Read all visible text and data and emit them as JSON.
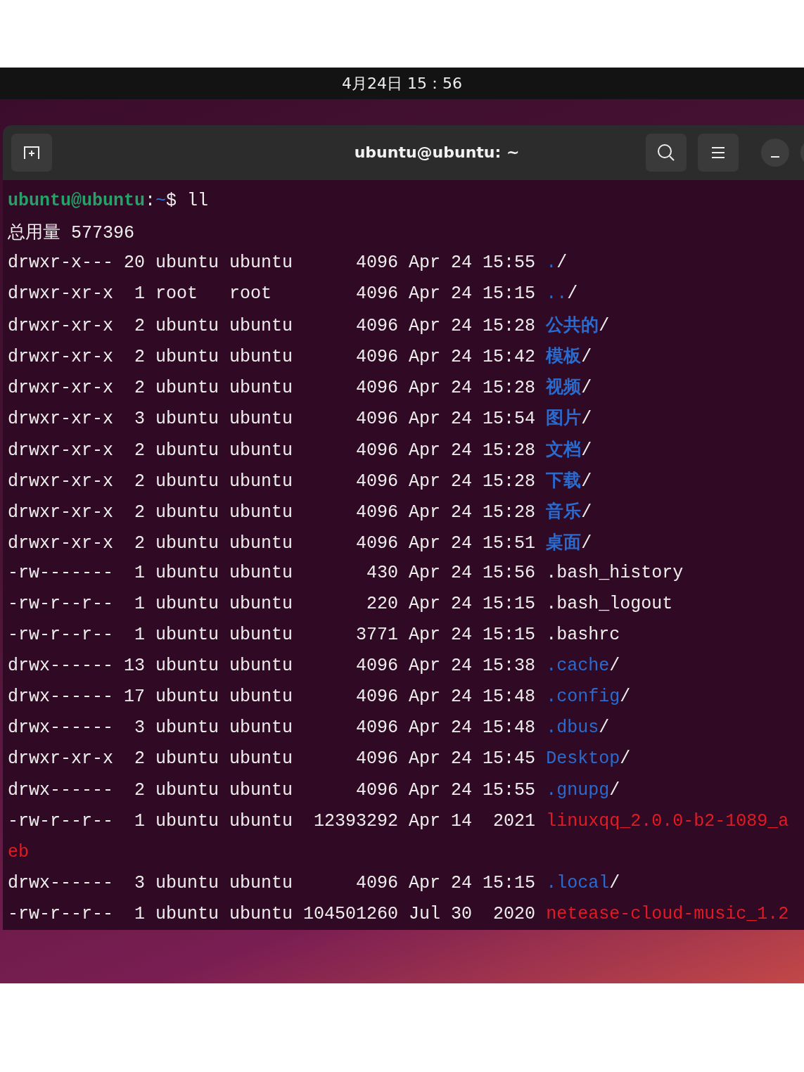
{
  "top_bar": {
    "clock": "4月24日 15：56"
  },
  "window": {
    "title": "ubuntu@ubuntu: ~"
  },
  "terminal": {
    "lines": [
      {
        "kind": "prompt_line",
        "user": "ubuntu@ubuntu",
        "separator": ":",
        "path": "~",
        "symbol": "$",
        "command": "ll"
      },
      {
        "kind": "text_line",
        "text": "总用量 577396"
      },
      {
        "kind": "dir_entry",
        "listing": "drwxr-x--- 20 ubuntu ubuntu      4096 Apr 24 15:55",
        "name": ".",
        "suffix": "/"
      },
      {
        "kind": "dir_entry",
        "listing": "drwxr-xr-x  1 root   root        4096 Apr 24 15:15",
        "name": "..",
        "suffix": "/"
      },
      {
        "kind": "dir_entry",
        "listing": "drwxr-xr-x  2 ubuntu ubuntu      4096 Apr 24 15:28",
        "name": "公共的",
        "suffix": "/"
      },
      {
        "kind": "dir_entry",
        "listing": "drwxr-xr-x  2 ubuntu ubuntu      4096 Apr 24 15:42",
        "name": "模板",
        "suffix": "/"
      },
      {
        "kind": "dir_entry",
        "listing": "drwxr-xr-x  2 ubuntu ubuntu      4096 Apr 24 15:28",
        "name": "视频",
        "suffix": "/"
      },
      {
        "kind": "dir_entry",
        "listing": "drwxr-xr-x  3 ubuntu ubuntu      4096 Apr 24 15:54",
        "name": "图片",
        "suffix": "/"
      },
      {
        "kind": "dir_entry",
        "listing": "drwxr-xr-x  2 ubuntu ubuntu      4096 Apr 24 15:28",
        "name": "文档",
        "suffix": "/"
      },
      {
        "kind": "dir_entry",
        "listing": "drwxr-xr-x  2 ubuntu ubuntu      4096 Apr 24 15:28",
        "name": "下载",
        "suffix": "/"
      },
      {
        "kind": "dir_entry",
        "listing": "drwxr-xr-x  2 ubuntu ubuntu      4096 Apr 24 15:28",
        "name": "音乐",
        "suffix": "/"
      },
      {
        "kind": "dir_entry",
        "listing": "drwxr-xr-x  2 ubuntu ubuntu      4096 Apr 24 15:51",
        "name": "桌面",
        "suffix": "/"
      },
      {
        "kind": "file_entry",
        "listing": "-rw-------  1 ubuntu ubuntu       430 Apr 24 15:56",
        "name": ".bash_history"
      },
      {
        "kind": "file_entry",
        "listing": "-rw-r--r--  1 ubuntu ubuntu       220 Apr 24 15:15",
        "name": ".bash_logout"
      },
      {
        "kind": "file_entry",
        "listing": "-rw-r--r--  1 ubuntu ubuntu      3771 Apr 24 15:15",
        "name": ".bashrc"
      },
      {
        "kind": "dir_entry",
        "listing": "drwx------ 13 ubuntu ubuntu      4096 Apr 24 15:38",
        "name": ".cache",
        "suffix": "/"
      },
      {
        "kind": "dir_entry",
        "listing": "drwx------ 17 ubuntu ubuntu      4096 Apr 24 15:48",
        "name": ".config",
        "suffix": "/"
      },
      {
        "kind": "dir_entry",
        "listing": "drwx------  3 ubuntu ubuntu      4096 Apr 24 15:48",
        "name": ".dbus",
        "suffix": "/"
      },
      {
        "kind": "dir_entry",
        "listing": "drwxr-xr-x  2 ubuntu ubuntu      4096 Apr 24 15:45",
        "name": "Desktop",
        "suffix": "/"
      },
      {
        "kind": "dir_entry",
        "listing": "drwx------  2 ubuntu ubuntu      4096 Apr 24 15:55",
        "name": ".gnupg",
        "suffix": "/"
      },
      {
        "kind": "archive_entry",
        "listing": "-rw-r--r--  1 ubuntu ubuntu  12393292 Apr 14  2021",
        "name": "linuxqq_2.0.0-b2-1089_a"
      },
      {
        "kind": "archive_wrap",
        "text": "eb"
      },
      {
        "kind": "dir_entry",
        "listing": "drwx------  3 ubuntu ubuntu      4096 Apr 24 15:15",
        "name": ".local",
        "suffix": "/"
      },
      {
        "kind": "archive_entry",
        "listing": "-rw-r--r--  1 ubuntu ubuntu 104501260 Jul 30  2020",
        "name": "netease-cloud-music_1.2"
      }
    ]
  }
}
